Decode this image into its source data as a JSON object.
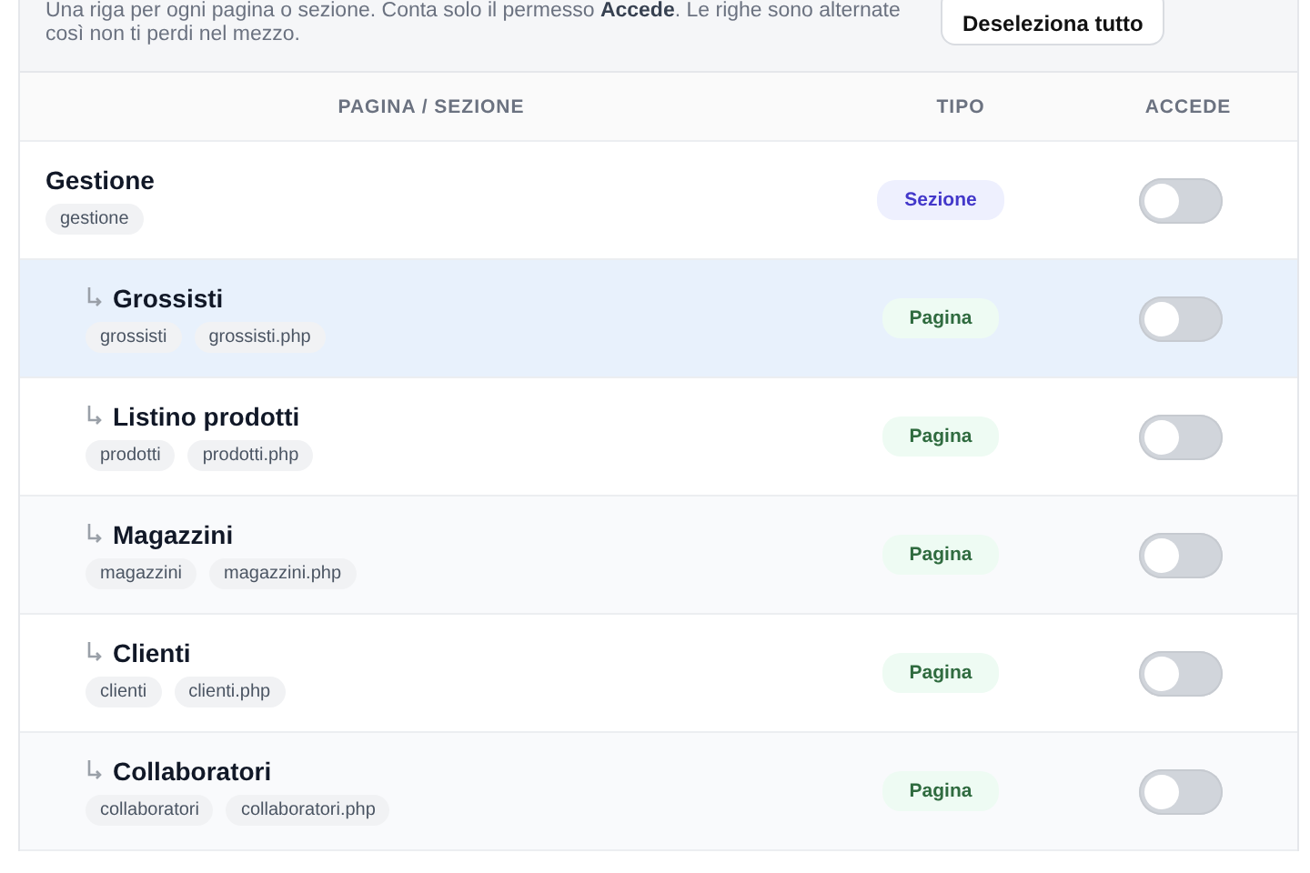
{
  "intro": {
    "text": "Una riga per ogni pagina o sezione. Conta solo il permesso **Accede**. Le righe sono alternate così non ti perdi nel mezzo.",
    "button": "Deseleziona tutto"
  },
  "table": {
    "columns": [
      "PAGINA / SEZIONE",
      "TIPO",
      "ACCEDE"
    ],
    "rows": [
      {
        "title": "Gestione",
        "tags": [
          "gestione"
        ],
        "type": "Sezione",
        "kind": "section",
        "on": false,
        "highlighted": false,
        "children": [
          {
            "title": "Grossisti",
            "tags": [
              "grossisti",
              "grossisti.php"
            ],
            "type": "Pagina",
            "kind": "page",
            "on": false,
            "highlighted": true
          },
          {
            "title": "Listino prodotti",
            "tags": [
              "prodotti",
              "prodotti.php"
            ],
            "type": "Pagina",
            "kind": "page",
            "on": false,
            "highlighted": false
          },
          {
            "title": "Magazzini",
            "tags": [
              "magazzini",
              "magazzini.php"
            ],
            "type": "Pagina",
            "kind": "page",
            "on": false,
            "highlighted": false
          },
          {
            "title": "Clienti",
            "tags": [
              "clienti",
              "clienti.php"
            ],
            "type": "Pagina",
            "kind": "page",
            "on": false,
            "highlighted": false
          },
          {
            "title": "Collaboratori",
            "tags": [
              "collaboratori",
              "collaboratori.php"
            ],
            "type": "Pagina",
            "kind": "page",
            "on": false,
            "highlighted": false
          }
        ]
      }
    ]
  }
}
